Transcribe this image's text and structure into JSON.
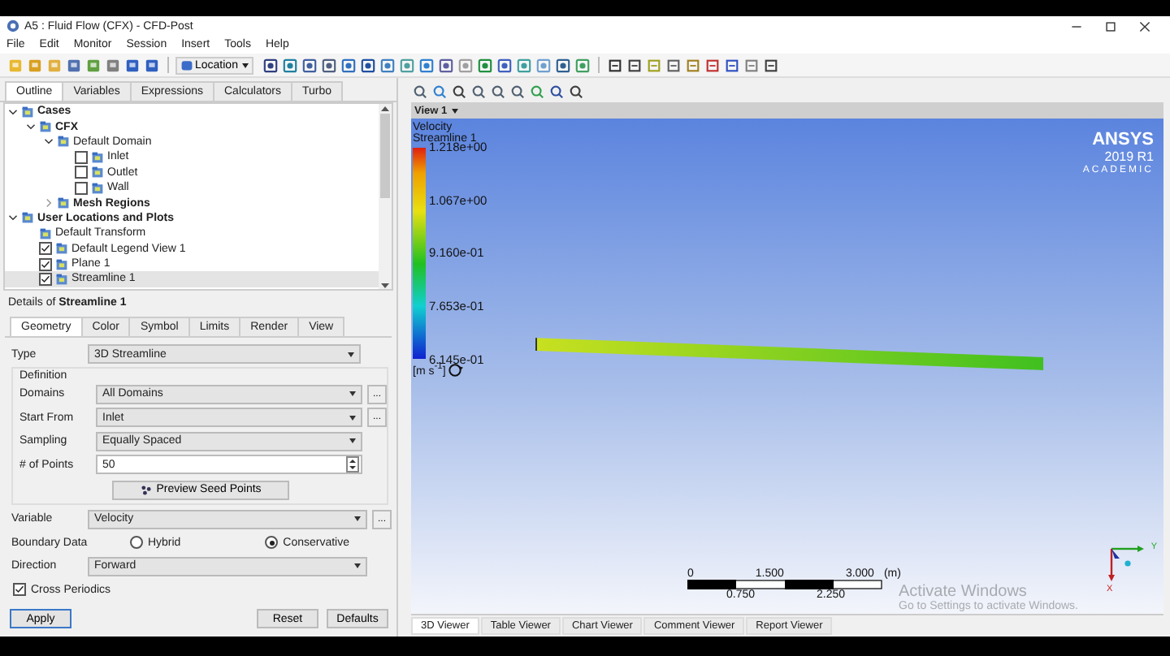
{
  "window": {
    "title": "A5 : Fluid Flow (CFX) - CFD-Post"
  },
  "menu": [
    "File",
    "Edit",
    "Monitor",
    "Session",
    "Insert",
    "Tools",
    "Help"
  ],
  "toolbar": {
    "location_label": "Location"
  },
  "left_tabs": [
    {
      "label": "Outline",
      "selected": true
    },
    {
      "label": "Variables",
      "selected": false
    },
    {
      "label": "Expressions",
      "selected": false
    },
    {
      "label": "Calculators",
      "selected": false
    },
    {
      "label": "Turbo",
      "selected": false
    }
  ],
  "tree": [
    {
      "label": "Cases",
      "bold": true,
      "expanded": true,
      "selected": false,
      "children": [
        {
          "label": "CFX",
          "bold": true,
          "expanded": true,
          "selected": false,
          "children": [
            {
              "label": "Default Domain",
              "bold": false,
              "expanded": true,
              "selected": false,
              "children": [
                {
                  "label": "Inlet",
                  "bold": false,
                  "checked": false,
                  "selected": false
                },
                {
                  "label": "Outlet",
                  "bold": false,
                  "checked": false,
                  "selected": false
                },
                {
                  "label": "Wall",
                  "bold": false,
                  "checked": false,
                  "selected": false
                }
              ]
            },
            {
              "label": "Mesh Regions",
              "bold": true,
              "expanded": false,
              "selected": false
            }
          ]
        }
      ]
    },
    {
      "label": "User Locations and Plots",
      "bold": true,
      "expanded": true,
      "selected": false,
      "children": [
        {
          "label": "Default Transform",
          "bold": false,
          "selected": false
        },
        {
          "label": "Default Legend View 1",
          "bold": false,
          "checked": true,
          "selected": false
        },
        {
          "label": "Plane 1",
          "bold": false,
          "checked": true,
          "selected": false
        },
        {
          "label": "Streamline 1",
          "bold": false,
          "checked": true,
          "selected": true
        }
      ]
    }
  ],
  "details": {
    "title": "Details of **Streamline 1**",
    "tabs": [
      {
        "label": "Geometry",
        "selected": true
      },
      {
        "label": "Color",
        "selected": false
      },
      {
        "label": "Symbol",
        "selected": false
      },
      {
        "label": "Limits",
        "selected": false
      },
      {
        "label": "Render",
        "selected": false
      },
      {
        "label": "View",
        "selected": false
      }
    ],
    "type": {
      "label": "Type",
      "value": "3D Streamline"
    },
    "group_title": "Definition",
    "definition_rows": [
      {
        "kind": "select",
        "label": "Domains",
        "value": "All Domains",
        "more": "..."
      },
      {
        "kind": "select",
        "label": "Start From",
        "value": "Inlet",
        "more": "..."
      },
      {
        "kind": "select",
        "label": "Sampling",
        "value": "Equally Spaced"
      },
      {
        "kind": "spin",
        "label": "# of Points",
        "value": "50"
      },
      {
        "kind": "button",
        "label": "Preview Seed Points"
      }
    ],
    "rows": [
      {
        "kind": "select",
        "label": "Variable",
        "value": "Velocity",
        "more": "..."
      },
      {
        "kind": "radio",
        "label": "Boundary Data",
        "options": [
          {
            "label": "Hybrid",
            "selected": false
          },
          {
            "label": "Conservative",
            "selected": true
          }
        ]
      },
      {
        "kind": "select",
        "label": "Direction",
        "value": "Forward"
      }
    ],
    "cross_periodics": {
      "label": "Cross Periodics",
      "checked": true
    },
    "buttons": [
      {
        "label": "Apply",
        "kind": "primary"
      },
      {
        "label": "Reset",
        "kind": "plain"
      },
      {
        "label": "Defaults",
        "kind": "plain"
      }
    ]
  },
  "viewer": {
    "view_title": "View 1",
    "legend": {
      "title": "Velocity",
      "subtitle": "Streamline 1",
      "ticks": [
        "1.218e+00",
        "1.067e+00",
        "9.160e-01",
        "7.653e-01",
        "6.145e-01"
      ],
      "unit": "[m s$^{-1}$]"
    },
    "logo": {
      "name": "ANSYS",
      "version": "2019 R1",
      "edition": "ACADEMIC"
    },
    "scale": {
      "top_labels": [
        "0",
        "1.500",
        "3.000"
      ],
      "unit": "(m)",
      "bottom_labels": [
        "0.750",
        "2.250"
      ]
    },
    "axes": {
      "y": "Y",
      "x": "X"
    },
    "activation": {
      "title": "Activate Windows",
      "text": "Go to Settings to activate Windows."
    },
    "tabs": [
      {
        "label": "3D Viewer",
        "selected": true
      },
      {
        "label": "Table Viewer",
        "selected": false
      },
      {
        "label": "Chart Viewer",
        "selected": false
      },
      {
        "label": "Comment Viewer",
        "selected": false
      },
      {
        "label": "Report Viewer",
        "selected": false
      }
    ]
  }
}
